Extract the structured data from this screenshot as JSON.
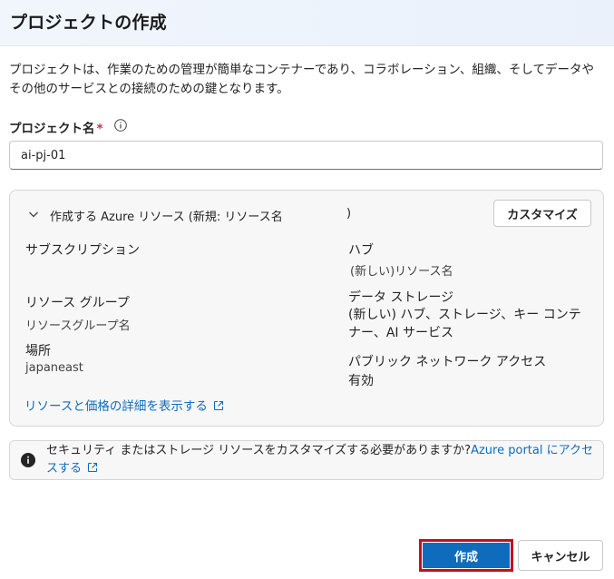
{
  "dialog": {
    "title": "プロジェクトの作成",
    "description": "プロジェクトは、作業のための管理が簡単なコンテナーであり、コラボレーション、組織、そしてデータやその他のサービスとの接続のための鍵となります。"
  },
  "project_name": {
    "label": "プロジェクト名",
    "required_marker": "*",
    "value": "ai-pj-01"
  },
  "resources_card": {
    "header": "作成する Azure リソース (新規: リソース名",
    "header_close": ")",
    "customize_label": "カスタマイズ",
    "subscription_label": "サブスクリプション",
    "hub_label": "ハブ",
    "hub_value": "(新しい)リソース名",
    "resource_group_label": "リソース グループ",
    "resource_group_value": "リソースグループ名",
    "storage_label": "データ ストレージ",
    "storage_value": "(新しい) ハブ、ストレージ、キー コンテナー、AI サービス",
    "location_label": "場所",
    "location_value": "japaneast",
    "network_label": "パブリック ネットワーク アクセス",
    "network_value": "有効",
    "details_link": "リソースと価格の詳細を表示する"
  },
  "notice": {
    "text": "セキュリティ またはストレージ リソースをカスタマイズする必要がありますか?",
    "link": "Azure portal にアクセスする"
  },
  "footer": {
    "create_label": "作成",
    "cancel_label": "キャンセル"
  },
  "colors": {
    "accent": "#0f6cbd",
    "highlight_border": "#c50f1f",
    "required": "#c4314b"
  }
}
